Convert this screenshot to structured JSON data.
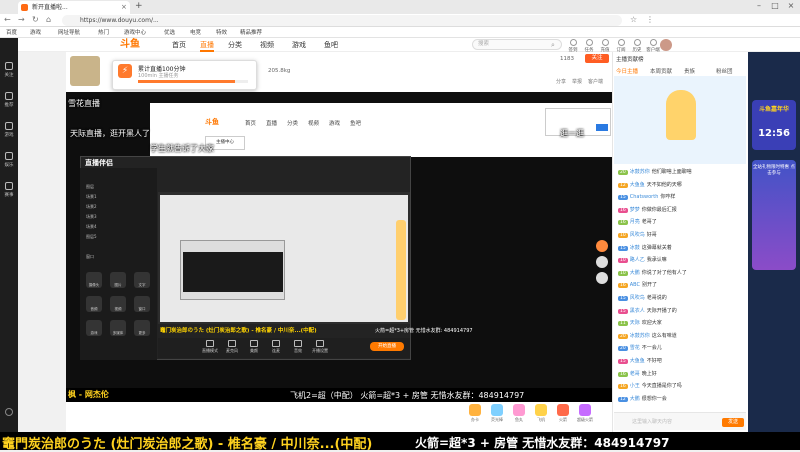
{
  "browser": {
    "tab_title": "新开直播啦...",
    "url": "https://www.douyu.com/...",
    "bookmarks": [
      "百度",
      "游戏",
      "网址导航",
      "热门",
      "游戏中心",
      "优选",
      "电竞",
      "特效",
      "精品推荐"
    ]
  },
  "sidebar": {
    "items": [
      "关注",
      "推荐",
      "游戏",
      "娱乐",
      "赛事"
    ]
  },
  "site": {
    "logo": "斗鱼",
    "nav": [
      "首页",
      "直播",
      "分类",
      "视频",
      "游戏",
      "鱼吧"
    ],
    "search_placeholder": "搜索",
    "header_icons": [
      "签到",
      "任务",
      "充值",
      "订阅",
      "历史",
      "客户端",
      "创作",
      "下载"
    ]
  },
  "room": {
    "popup_title": "累计直播100分钟",
    "popup_sub": "100min 主播任务",
    "popup_progress": 0.88,
    "score": "205.8kg",
    "follow_count": "1183",
    "follow_label": "关注",
    "actions": [
      "分享",
      "举报",
      "客户端"
    ]
  },
  "video": {
    "danmu": [
      "天际直播，逛开黑人了",
      "学生就告诉了大家",
      "雪花直播",
      "逛一逛"
    ],
    "nested_logo": "斗鱼",
    "nested_nav": [
      "首页",
      "直播",
      "分类",
      "视频",
      "游戏",
      "鱼吧"
    ],
    "nested_popup": "主播中心",
    "obs_title": "直播伴侣",
    "obs_rows": [
      "图层",
      "场景1",
      "场景2",
      "场景3",
      "场景4",
      "图层5",
      "窗口"
    ],
    "obs_tools": [
      "摄像头",
      "图片",
      "文字",
      "音频",
      "视频",
      "窗口",
      "游戏",
      "多媒体",
      "更多"
    ],
    "obs_caption": "竈门炭治郎のうた (灶门炭治郎之歌) - 椎名豪 / 中川奈...(中配)",
    "obs_group": "火箭=超*3+房管  无惜水友群: 484914797",
    "obs_controls": [
      "直播模式",
      "麦克风",
      "美颜",
      "连麦",
      "音效",
      "开播设置"
    ],
    "obs_start": "开始直播",
    "inner_name": "枫 - 网杰伦",
    "inner_text": "飞机2=超（中配）      火箭=超*3 + 房管      无惜水友群：484914797"
  },
  "gifts": [
    "办卡",
    "荧光棒",
    "鱼丸",
    "飞机",
    "火箭",
    "超级火箭"
  ],
  "chat": {
    "tabs": [
      "今日主播",
      "本周贡献",
      "贵族",
      "粉丝团"
    ],
    "rank_label": "主播贡献榜",
    "messages": [
      {
        "lv": "20",
        "name": "冰鼓苏你",
        "text": "他们聊啥上面聊啥"
      },
      {
        "lv": "12",
        "name": "大鱼鱼",
        "text": "天不如他的天哪"
      },
      {
        "lv": "15",
        "name": "Chatsworth",
        "text": "你咋样"
      },
      {
        "lv": "16",
        "name": "梦梦",
        "text": "你做你最后汇报"
      },
      {
        "lv": "16",
        "name": "月亮",
        "text": "老哥了"
      },
      {
        "lv": "10",
        "name": "风吹鸟",
        "text": "好哥"
      },
      {
        "lv": "15",
        "name": "冰鼓",
        "text": "这弹幕就关着"
      },
      {
        "lv": "10",
        "name": "路人乙",
        "text": "我承认嘛"
      },
      {
        "lv": "10",
        "name": "大鹏",
        "text": "你说了对了他有人了"
      },
      {
        "lv": "16",
        "name": "ABC",
        "text": "别开了"
      },
      {
        "lv": "15",
        "name": "风吹鸟",
        "text": "老哥说的"
      },
      {
        "lv": "15",
        "name": "黑衣人",
        "text": "天际开播了的"
      },
      {
        "lv": "11",
        "name": "天际",
        "text": "欢迎大家"
      },
      {
        "lv": "20",
        "name": "冰鼓苏你",
        "text": "这么有味道"
      },
      {
        "lv": "20",
        "name": "雪花",
        "text": "不一会儿"
      },
      {
        "lv": "15",
        "name": "大鱼鱼",
        "text": "不好吧"
      },
      {
        "lv": "16",
        "name": "老哥",
        "text": "晚上好"
      },
      {
        "lv": "16",
        "name": "小王",
        "text": "今天直播是你了吗"
      },
      {
        "lv": "12",
        "name": "大鹏",
        "text": "很想你一会"
      }
    ],
    "input_placeholder": "这里输入聊天内容",
    "send_label": "发送"
  },
  "promo": {
    "top": "斗鱼嘉年华",
    "clock": "12:56",
    "text": "全站礼物限时特惠 点击参与"
  },
  "banner": {
    "song": "竈門炭治郎のうた (灶门炭治郎之歌) - 椎名豪 / 中川奈...(中配)",
    "ticker": "火箭=超*3 + 房管      无惜水友群：484914797"
  }
}
